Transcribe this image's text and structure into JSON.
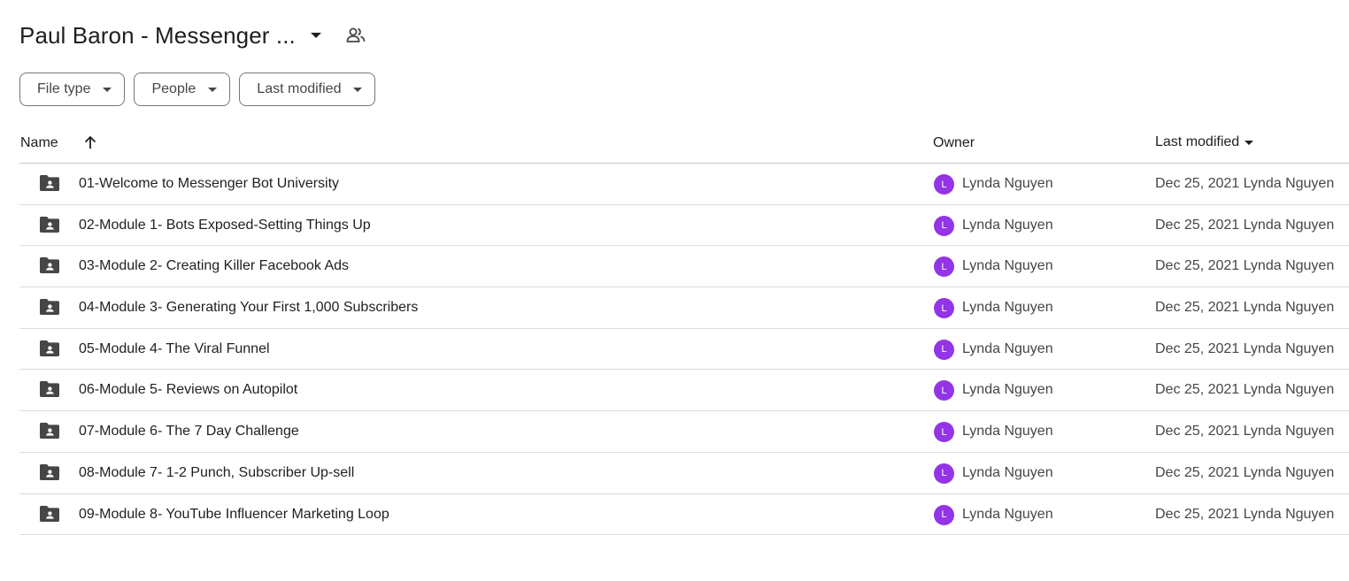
{
  "header": {
    "title": "Paul Baron - Messenger ...",
    "caret_icon": "arrow-drop-down-icon",
    "shared_icon": "people-icon"
  },
  "filters": [
    {
      "label": "File type"
    },
    {
      "label": "People"
    },
    {
      "label": "Last modified"
    }
  ],
  "columns": {
    "name": "Name",
    "owner": "Owner",
    "last_modified": "Last modified",
    "sort_icon": "arrow-upward-icon"
  },
  "colors": {
    "avatar": "#9334e6",
    "folder": "#444746",
    "border": "#747775"
  },
  "files": [
    {
      "name": "01-Welcome to Messenger Bot University",
      "owner_initial": "L",
      "owner": "Lynda Nguyen",
      "modified": "Dec 25, 2021 Lynda Nguyen"
    },
    {
      "name": "02-Module 1- Bots Exposed-Setting Things Up",
      "owner_initial": "L",
      "owner": "Lynda Nguyen",
      "modified": "Dec 25, 2021 Lynda Nguyen"
    },
    {
      "name": "03-Module 2- Creating Killer Facebook Ads",
      "owner_initial": "L",
      "owner": "Lynda Nguyen",
      "modified": "Dec 25, 2021 Lynda Nguyen"
    },
    {
      "name": "04-Module 3- Generating Your First 1,000 Subscribers",
      "owner_initial": "L",
      "owner": "Lynda Nguyen",
      "modified": "Dec 25, 2021 Lynda Nguyen"
    },
    {
      "name": "05-Module 4- The Viral Funnel",
      "owner_initial": "L",
      "owner": "Lynda Nguyen",
      "modified": "Dec 25, 2021 Lynda Nguyen"
    },
    {
      "name": "06-Module 5- Reviews on Autopilot",
      "owner_initial": "L",
      "owner": "Lynda Nguyen",
      "modified": "Dec 25, 2021 Lynda Nguyen"
    },
    {
      "name": "07-Module 6- The 7 Day Challenge",
      "owner_initial": "L",
      "owner": "Lynda Nguyen",
      "modified": "Dec 25, 2021 Lynda Nguyen"
    },
    {
      "name": "08-Module 7- 1-2 Punch, Subscriber Up-sell",
      "owner_initial": "L",
      "owner": "Lynda Nguyen",
      "modified": "Dec 25, 2021 Lynda Nguyen"
    },
    {
      "name": "09-Module 8- YouTube Influencer Marketing Loop",
      "owner_initial": "L",
      "owner": "Lynda Nguyen",
      "modified": "Dec 25, 2021 Lynda Nguyen"
    }
  ]
}
